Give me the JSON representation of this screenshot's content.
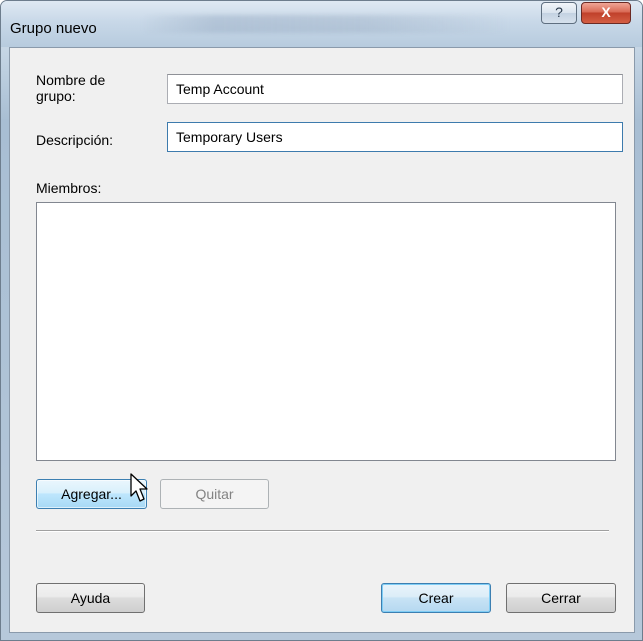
{
  "window": {
    "title": "Grupo nuevo",
    "help_glyph": "?",
    "close_glyph": "X"
  },
  "form": {
    "group_name_label": "Nombre de grupo:",
    "group_name_value": "Temp Account",
    "description_label": "Descripción:",
    "description_value": "Temporary Users",
    "members_label": "Miembros:",
    "members": []
  },
  "buttons": {
    "add": "Agregar...",
    "remove": "Quitar",
    "help": "Ayuda",
    "create": "Crear",
    "close": "Cerrar"
  },
  "icons": {
    "help": "help-icon",
    "close": "close-icon",
    "cursor": "mouse-pointer-icon"
  }
}
